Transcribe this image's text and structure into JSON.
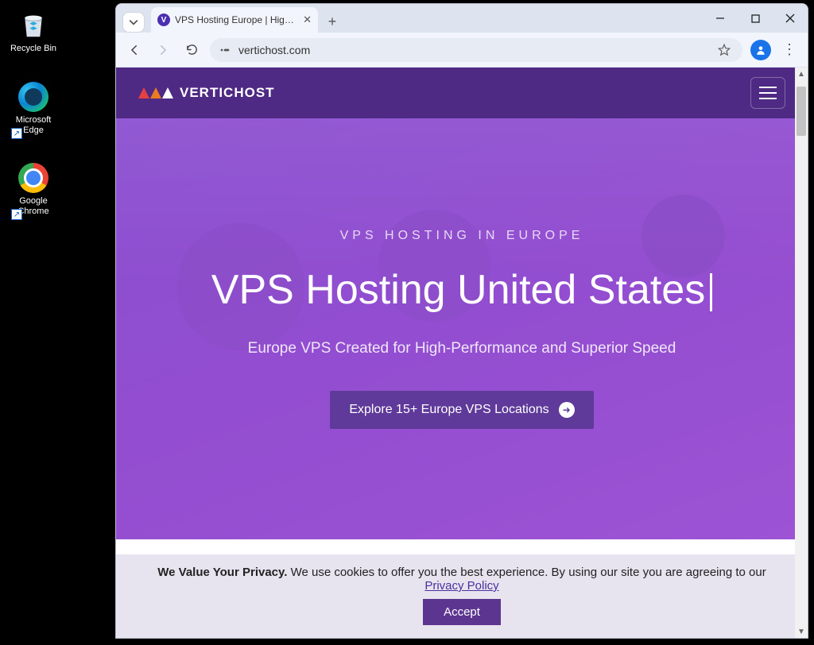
{
  "desktop": {
    "icons": [
      {
        "label": "Recycle Bin"
      },
      {
        "label": "Microsoft Edge"
      },
      {
        "label": "Google Chrome"
      }
    ]
  },
  "browser": {
    "tab": {
      "title": "VPS Hosting Europe | High-Perf",
      "favicon_letter": "V"
    },
    "url": "vertichost.com"
  },
  "site": {
    "brand": "VERTICHOST",
    "hero": {
      "eyebrow": "VPS HOSTING IN EUROPE",
      "headline": "VPS Hosting United States",
      "subhead": "Europe VPS Created for High-Performance and Superior Speed",
      "cta_label": "Explore 15+ Europe VPS Locations"
    },
    "cookie": {
      "lead_bold": "We Value Your Privacy.",
      "lead_rest": " We use cookies to offer you the best experience. By using our site you are agreeing to our ",
      "policy_link": "Privacy Policy",
      "accept": "Accept"
    }
  }
}
